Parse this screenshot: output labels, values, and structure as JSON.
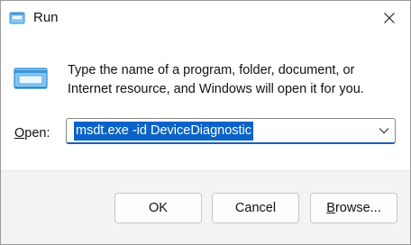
{
  "window": {
    "title": "Run",
    "close_icon": "close-icon",
    "app_icon": "run-icon"
  },
  "description": "Type the name of a program, folder, document, or Internet resource, and Windows will open it for you.",
  "open_field": {
    "label_prefix": "",
    "label_accel": "O",
    "label_rest": "pen:",
    "value": "msdt.exe -id DeviceDiagnostic",
    "dropdown_icon": "chevron-down-icon"
  },
  "buttons": {
    "ok": "OK",
    "cancel": "Cancel",
    "browse_accel": "B",
    "browse_rest": "rowse..."
  },
  "colors": {
    "selection": "#0a63c7",
    "focus_border": "#1a5fb4",
    "footer_bg": "#f3f3f3"
  }
}
